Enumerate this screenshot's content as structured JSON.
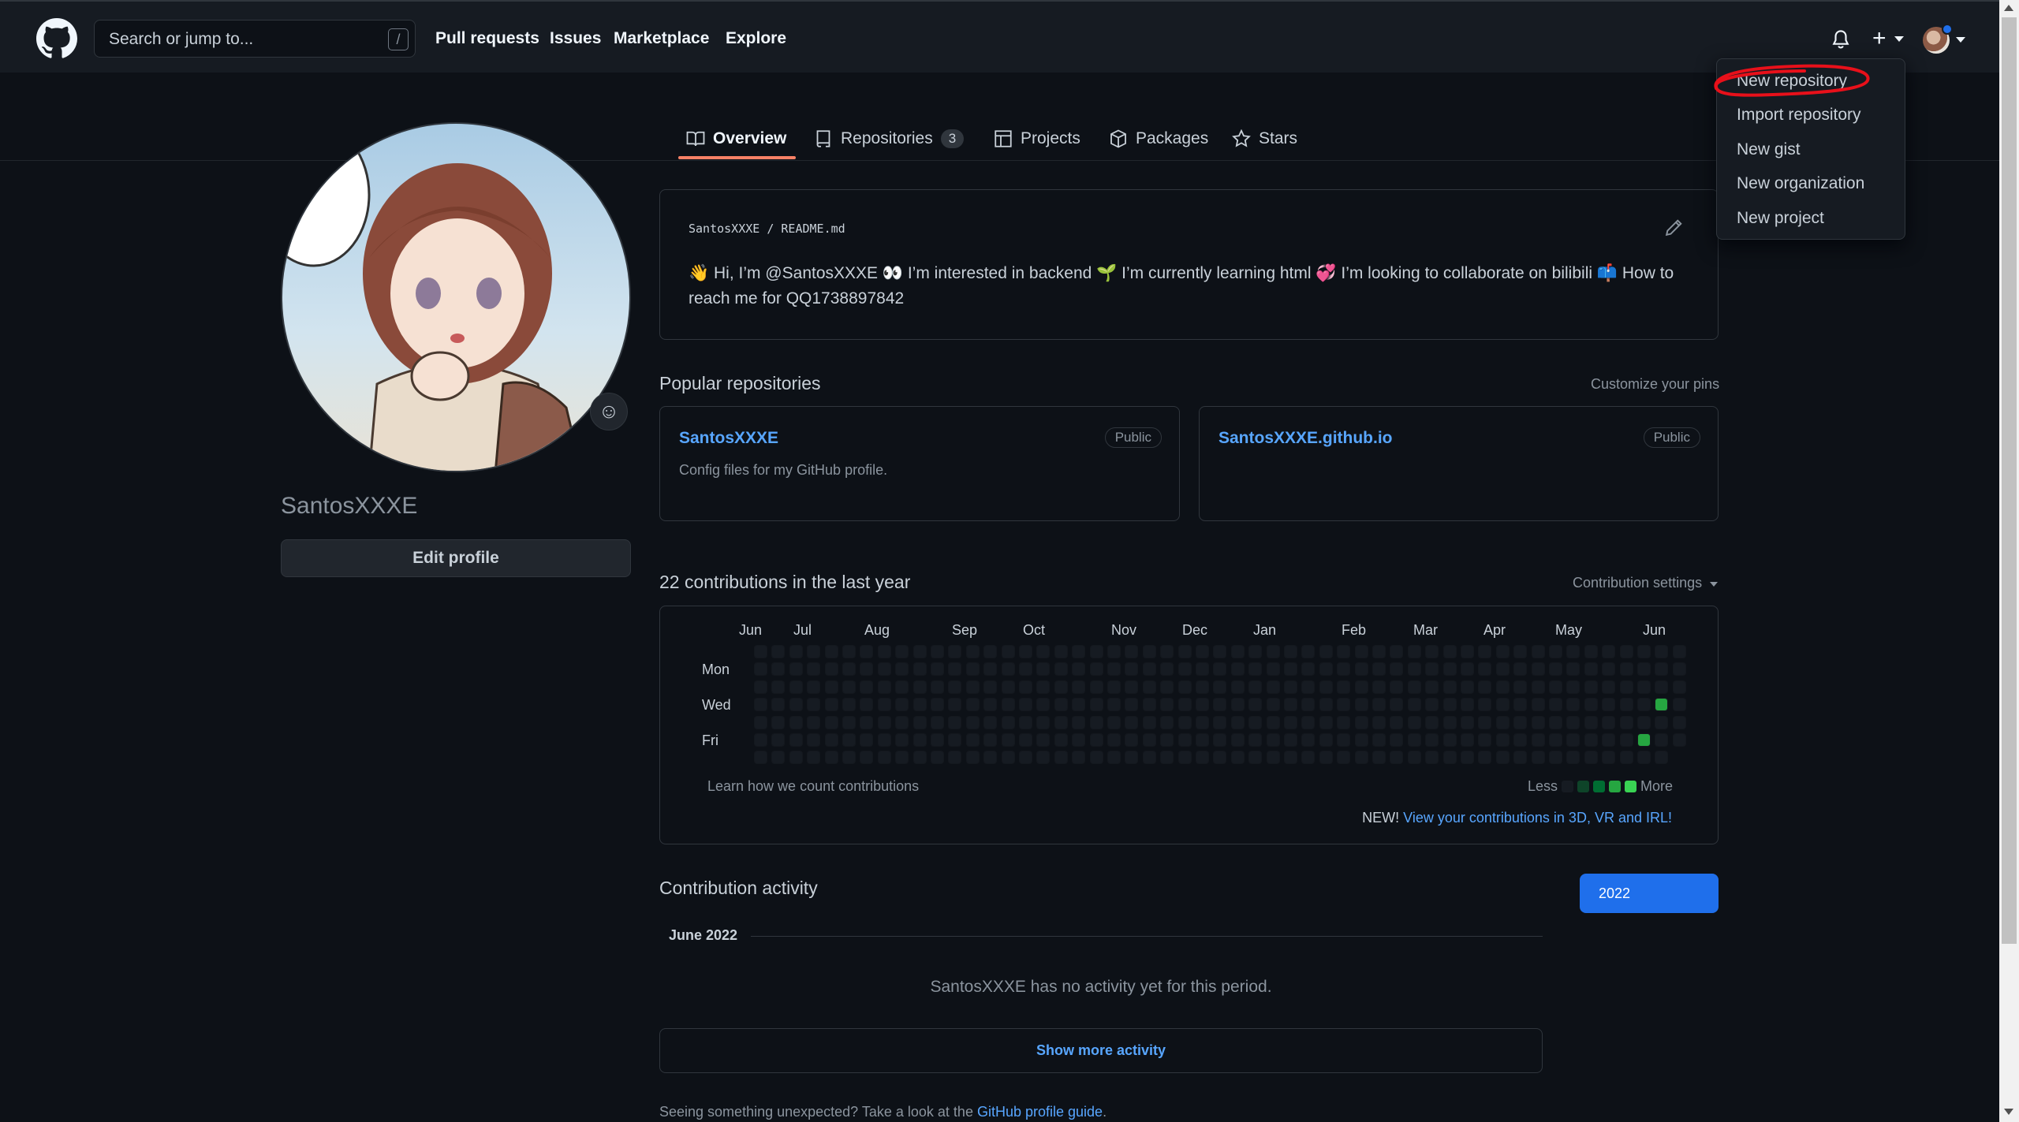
{
  "header": {
    "search_placeholder": "Search or jump to...",
    "slash_key": "/",
    "nav": [
      "Pull requests",
      "Issues",
      "Marketplace",
      "Explore"
    ]
  },
  "dropdown": {
    "items": [
      "New repository",
      "Import repository",
      "New gist",
      "New organization",
      "New project"
    ]
  },
  "tabs": [
    {
      "label": "Overview",
      "icon": "book-icon"
    },
    {
      "label": "Repositories",
      "icon": "repo-icon",
      "count": "3"
    },
    {
      "label": "Projects",
      "icon": "table-icon"
    },
    {
      "label": "Packages",
      "icon": "package-icon"
    },
    {
      "label": "Stars",
      "icon": "star-icon"
    }
  ],
  "profile": {
    "username": "SantosXXXE",
    "edit_label": "Edit profile",
    "emoji_icon": "☺"
  },
  "readme": {
    "owner": "SantosXXXE",
    "sep": "/",
    "file": "README.md",
    "line1": "👋 Hi, I’m @SantosXXXE 👀 I’m interested in backend 🌱 I’m currently learning html 💞️ I’m looking to collaborate on bilibili 📫 How to",
    "line2": "reach me for QQ1738897842"
  },
  "popular": {
    "title": "Popular repositories",
    "customize": "Customize your pins",
    "repos": [
      {
        "name": "SantosXXXE",
        "badge": "Public",
        "desc": "Config files for my GitHub profile."
      },
      {
        "name": "SantosXXXE.github.io",
        "badge": "Public",
        "desc": ""
      }
    ]
  },
  "contributions": {
    "title": "22 contributions in the last year",
    "settings": "Contribution settings",
    "months": [
      "Jun",
      "Jul",
      "Aug",
      "Sep",
      "Oct",
      "Nov",
      "Dec",
      "Jan",
      "Feb",
      "Mar",
      "Apr",
      "May",
      "Jun"
    ],
    "weekdays": [
      "Mon",
      "Wed",
      "Fri"
    ],
    "learn": "Learn how we count contributions",
    "less": "Less",
    "more": "More",
    "new_label": "NEW!",
    "new_link": "View your contributions in 3D, VR and IRL!",
    "colors": {
      "empty": "#161b22",
      "l1": "#0e4429",
      "l2": "#006d32",
      "l3": "#26a641",
      "l4": "#39d353"
    },
    "weeks": 53,
    "active_cells": [
      {
        "week": 51,
        "day": 3,
        "level": 3
      },
      {
        "week": 50,
        "day": 5,
        "level": 3
      }
    ]
  },
  "activity": {
    "title": "Contribution activity",
    "year": "2022",
    "month": "June 2022",
    "no_activity": "SantosXXXE has no activity yet for this period.",
    "show_more": "Show more activity",
    "footer_prefix": "Seeing something unexpected? Take a look at the",
    "footer_link": "GitHub profile guide",
    "footer_suffix": "."
  },
  "colors": {
    "background": "#0d1117",
    "header": "#161b22",
    "accent": "#58a6ff",
    "tab_underline": "#f78166",
    "year_button": "#1f6feb"
  }
}
